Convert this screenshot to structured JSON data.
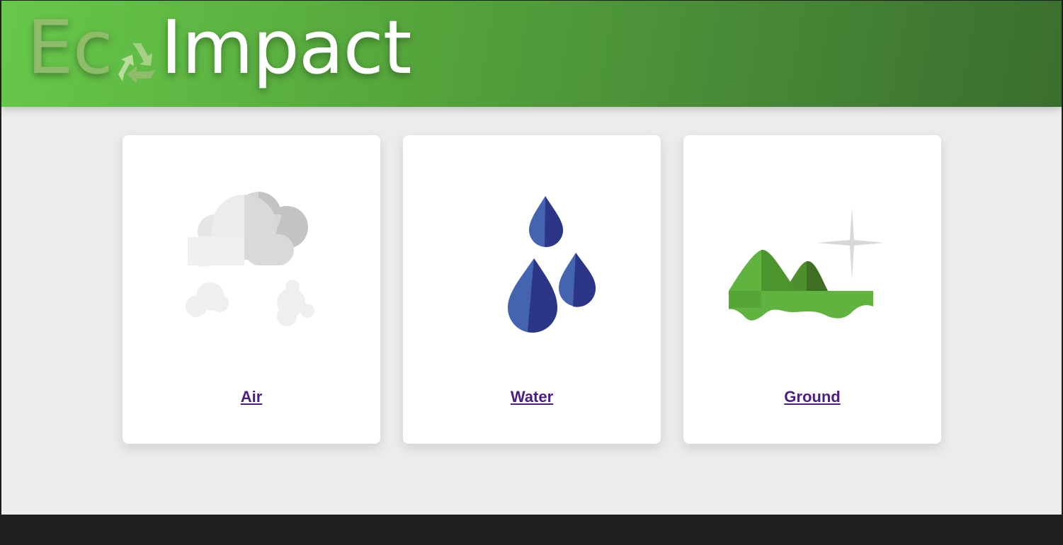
{
  "header": {
    "logo": {
      "eco_prefix": "Ec",
      "impact_text": "Impact",
      "icon": "recycle-icon"
    }
  },
  "cards": [
    {
      "label": "Air",
      "icon": "cloud-smoke-icon"
    },
    {
      "label": "Water",
      "icon": "water-drops-icon"
    },
    {
      "label": "Ground",
      "icon": "landscape-hills-icon"
    }
  ],
  "colors": {
    "header_start": "#67c84a",
    "header_end": "#3a6e2e",
    "link": "#4b1f82",
    "background": "#ececec",
    "footer": "#1f1f1f",
    "water_blue": "#4564b0",
    "water_dark": "#2b3687",
    "ground_green": "#5fb33e",
    "ground_dark": "#3f6d24"
  }
}
